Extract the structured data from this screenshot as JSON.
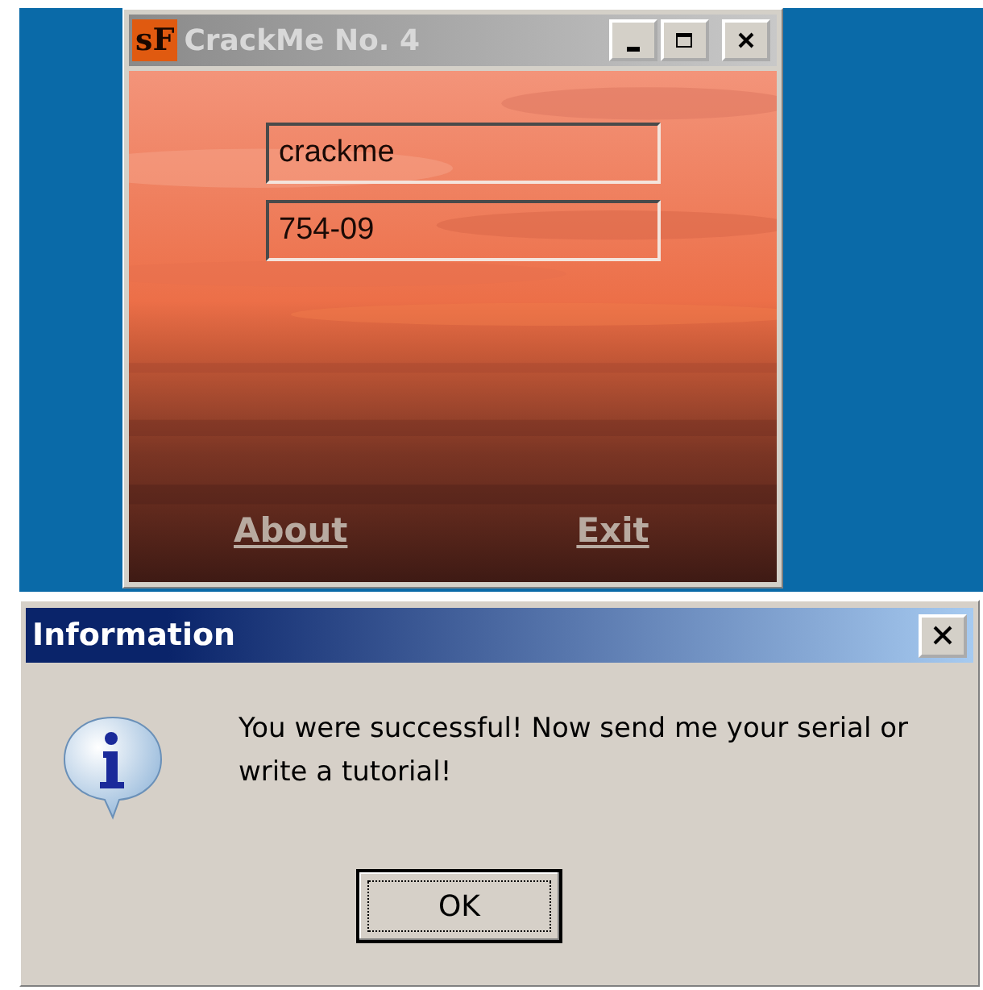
{
  "crackme_window": {
    "logo": "sF",
    "title": "CrackMe No. 4",
    "active": false,
    "fields": [
      {
        "value": "crackme"
      },
      {
        "value": "754-09"
      }
    ],
    "links": [
      "About",
      "Exit"
    ]
  },
  "dialog": {
    "title": "Information",
    "active": true,
    "message": "You were successful! Now send me your serial or write a tutorial!",
    "buttons": [
      {
        "label": "OK",
        "focused": true
      }
    ]
  }
}
